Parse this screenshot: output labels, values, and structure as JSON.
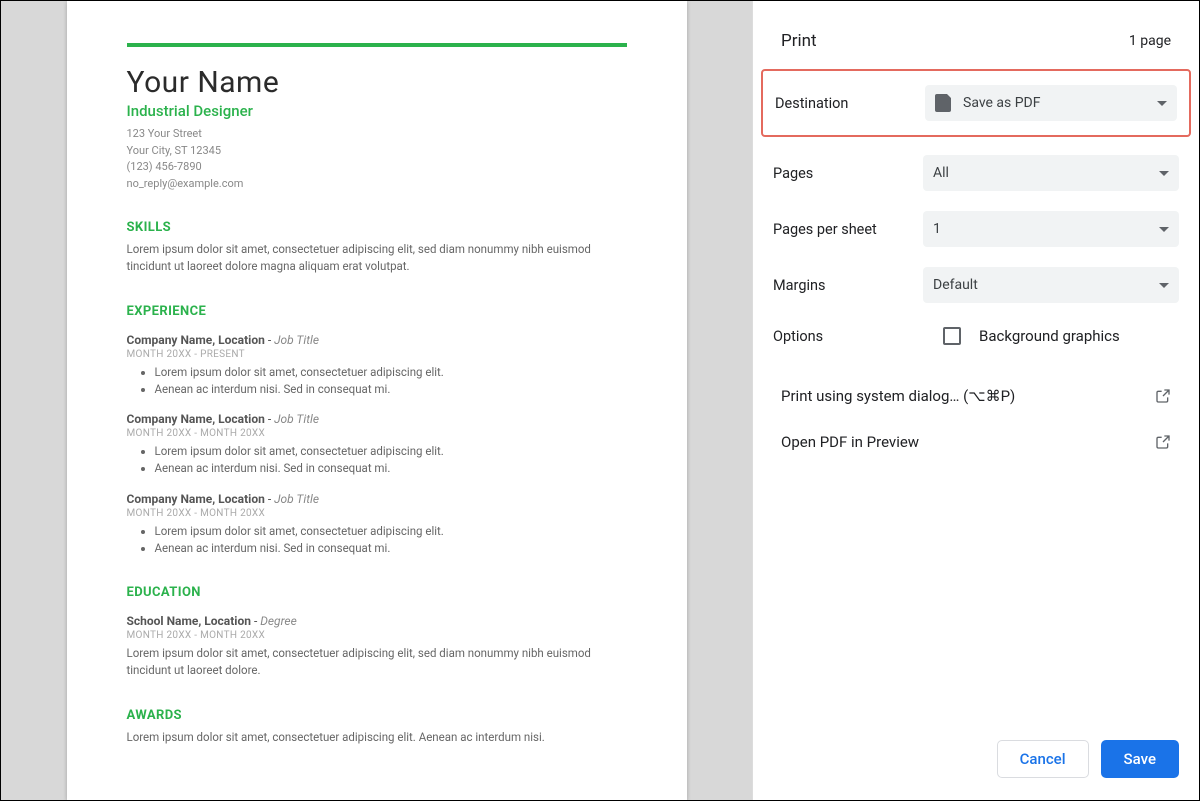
{
  "header": {
    "title": "Print",
    "page_count": "1 page"
  },
  "settings": {
    "destination": {
      "label": "Destination",
      "value": "Save as PDF"
    },
    "pages": {
      "label": "Pages",
      "value": "All"
    },
    "pps": {
      "label": "Pages per sheet",
      "value": "1"
    },
    "margins": {
      "label": "Margins",
      "value": "Default"
    },
    "options": {
      "label": "Options",
      "bg_label": "Background graphics"
    }
  },
  "links": {
    "system_dialog": "Print using system dialog… (⌥⌘P)",
    "open_preview": "Open PDF in Preview"
  },
  "buttons": {
    "cancel": "Cancel",
    "save": "Save"
  },
  "resume": {
    "name": "Your Name",
    "role": "Industrial Designer",
    "street": "123 Your Street",
    "city": "Your City, ST 12345",
    "phone": "(123) 456-7890",
    "email": "no_reply@example.com",
    "skills_title": "SKILLS",
    "skills_body": "Lorem ipsum dolor sit amet, consectetuer adipiscing elit, sed diam nonummy nibh euismod tincidunt ut laoreet dolore magna aliquam erat volutpat.",
    "exp_title": "EXPERIENCE",
    "exp": [
      {
        "company": "Company Name,  Location",
        "title": "Job Title",
        "dates": "MONTH 20XX - PRESENT",
        "b1": "Lorem ipsum dolor sit amet, consectetuer adipiscing elit.",
        "b2": "Aenean ac interdum nisi. Sed in consequat mi."
      },
      {
        "company": "Company Name, Location",
        "title": "Job Title",
        "dates": "MONTH 20XX - MONTH 20XX",
        "b1": "Lorem ipsum dolor sit amet, consectetuer adipiscing elit.",
        "b2": "Aenean ac interdum nisi. Sed in consequat mi."
      },
      {
        "company": "Company Name, Location",
        "title": "Job Title",
        "dates": "MONTH 20XX - MONTH 20XX",
        "b1": "Lorem ipsum dolor sit amet, consectetuer adipiscing elit.",
        "b2": "Aenean ac interdum nisi. Sed in consequat mi."
      }
    ],
    "edu_title": "EDUCATION",
    "edu_school": "School Name, Location",
    "edu_degree": "Degree",
    "edu_dates": "MONTH 20XX - MONTH 20XX",
    "edu_body": "Lorem ipsum dolor sit amet, consectetuer adipiscing elit, sed diam nonummy nibh euismod tincidunt ut laoreet dolore.",
    "awards_title": "AWARDS",
    "awards_body": "Lorem ipsum dolor sit amet, consectetuer adipiscing elit. Aenean ac interdum nisi."
  }
}
